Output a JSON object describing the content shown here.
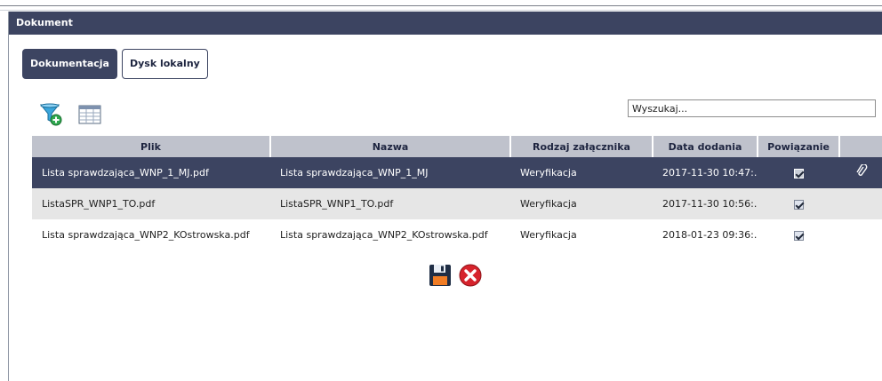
{
  "window": {
    "title": "Dokument"
  },
  "tabs": [
    {
      "label": "Dokumentacja",
      "active": true
    },
    {
      "label": "Dysk lokalny",
      "active": false
    }
  ],
  "search": {
    "value": "Wyszukaj..."
  },
  "table": {
    "headers": [
      "Plik",
      "Nazwa",
      "Rodzaj załącznika",
      "Data dodania",
      "Powiązanie",
      ""
    ],
    "rows": [
      {
        "plik": "Lista sprawdzająca_WNP_1_MJ.pdf",
        "nazwa": "Lista sprawdzająca_WNP_1_MJ",
        "rodzaj": "Weryfikacja",
        "data": "2017-11-30 10:47:...",
        "powiazanie": true
      },
      {
        "plik": "ListaSPR_WNP1_TO.pdf",
        "nazwa": "ListaSPR_WNP1_TO.pdf",
        "rodzaj": "Weryfikacja",
        "data": "2017-11-30 10:56:...",
        "powiazanie": true
      },
      {
        "plik": "Lista sprawdzająca_WNP2_KOstrowska.pdf",
        "nazwa": "Lista sprawdzająca_WNP2_KOstrowska.pdf",
        "rodzaj": "Weryfikacja",
        "data": "2018-01-23 09:36:...",
        "powiazanie": true
      }
    ]
  },
  "icons": {
    "filter": "filter-add-icon",
    "columns": "table-columns-icon",
    "attachment": "paperclip-icon",
    "save": "floppy-disk-icon",
    "cancel": "red-x-icon"
  },
  "colors": {
    "header": "#3c4461",
    "selected_row": "#3c4461",
    "column_header": "#bfc2cc",
    "alt_row": "#e6e6e6"
  }
}
